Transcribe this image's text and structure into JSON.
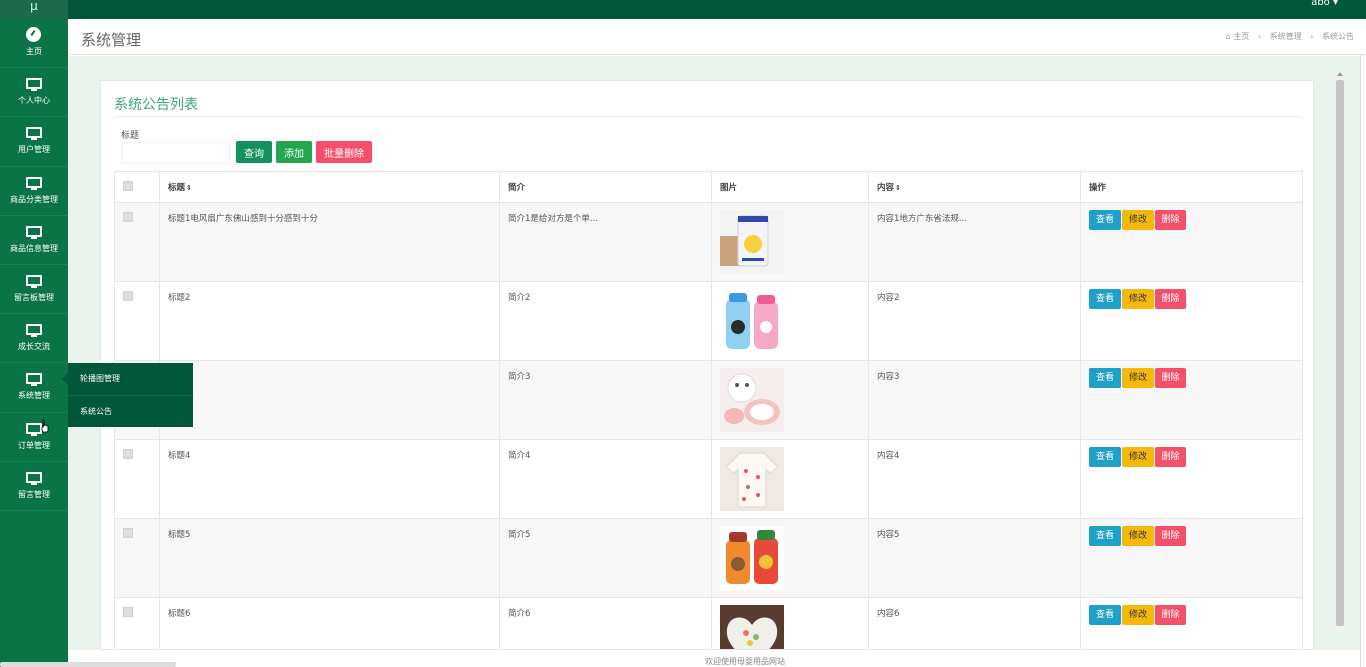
{
  "topbar": {
    "logo": "μ",
    "user": "abo ▾"
  },
  "sidebar": {
    "items": [
      {
        "label": "主页",
        "icon": "dashboard-icon"
      },
      {
        "label": "个人中心",
        "icon": "monitor-icon"
      },
      {
        "label": "用户管理",
        "icon": "monitor-icon"
      },
      {
        "label": "商品分类管理",
        "icon": "monitor-icon"
      },
      {
        "label": "商品信息管理",
        "icon": "monitor-icon"
      },
      {
        "label": "留言板管理",
        "icon": "monitor-icon"
      },
      {
        "label": "成长交流",
        "icon": "monitor-icon"
      },
      {
        "label": "系统管理",
        "icon": "monitor-icon"
      },
      {
        "label": "订单管理",
        "icon": "monitor-icon"
      },
      {
        "label": "留言管理",
        "icon": "monitor-icon"
      }
    ],
    "flyout": [
      "轮播图管理",
      "系统公告"
    ]
  },
  "header": {
    "title": "系统管理",
    "breadcrumb": {
      "home": "主页",
      "level1": "系统管理",
      "level2": "系统公告"
    }
  },
  "panel": {
    "title": "系统公告列表",
    "search_label": "标题",
    "search_value": "",
    "btn_query": "查询",
    "btn_add": "添加",
    "btn_batch_delete": "批量删除"
  },
  "table": {
    "headers": {
      "title": "标题",
      "intro": "简介",
      "image": "图片",
      "content": "内容",
      "ops": "操作"
    },
    "sort_glyph": "⇕",
    "ops": {
      "view": "查看",
      "edit": "修改",
      "delete": "删除"
    },
    "rows": [
      {
        "title": "标题1电风扇广东佛山感到十分感到十分",
        "intro": "简介1是给对方是个单...",
        "content": "内容1地方广东省法规...",
        "image": "milk-powder"
      },
      {
        "title": "标题2",
        "intro": "简介2",
        "content": "内容2",
        "image": "water-bottles"
      },
      {
        "title": "",
        "intro": "简介3",
        "content": "内容3",
        "image": "baby-tableware"
      },
      {
        "title": "标题4",
        "intro": "简介4",
        "content": "内容4",
        "image": "baby-romper"
      },
      {
        "title": "标题5",
        "intro": "简介5",
        "content": "内容5",
        "image": "thermos-cups"
      },
      {
        "title": "标题6",
        "intro": "简介6",
        "content": "内容6",
        "image": "heart-bowl"
      }
    ]
  },
  "footer": {
    "text": "欢迎使用母婴用品网站"
  },
  "colors": {
    "primary": "#00573a",
    "sidebar": "#0a7447",
    "accent": "#3aa873",
    "danger": "#f4506a",
    "warning": "#f5b80d",
    "info": "#1fa0c7"
  }
}
